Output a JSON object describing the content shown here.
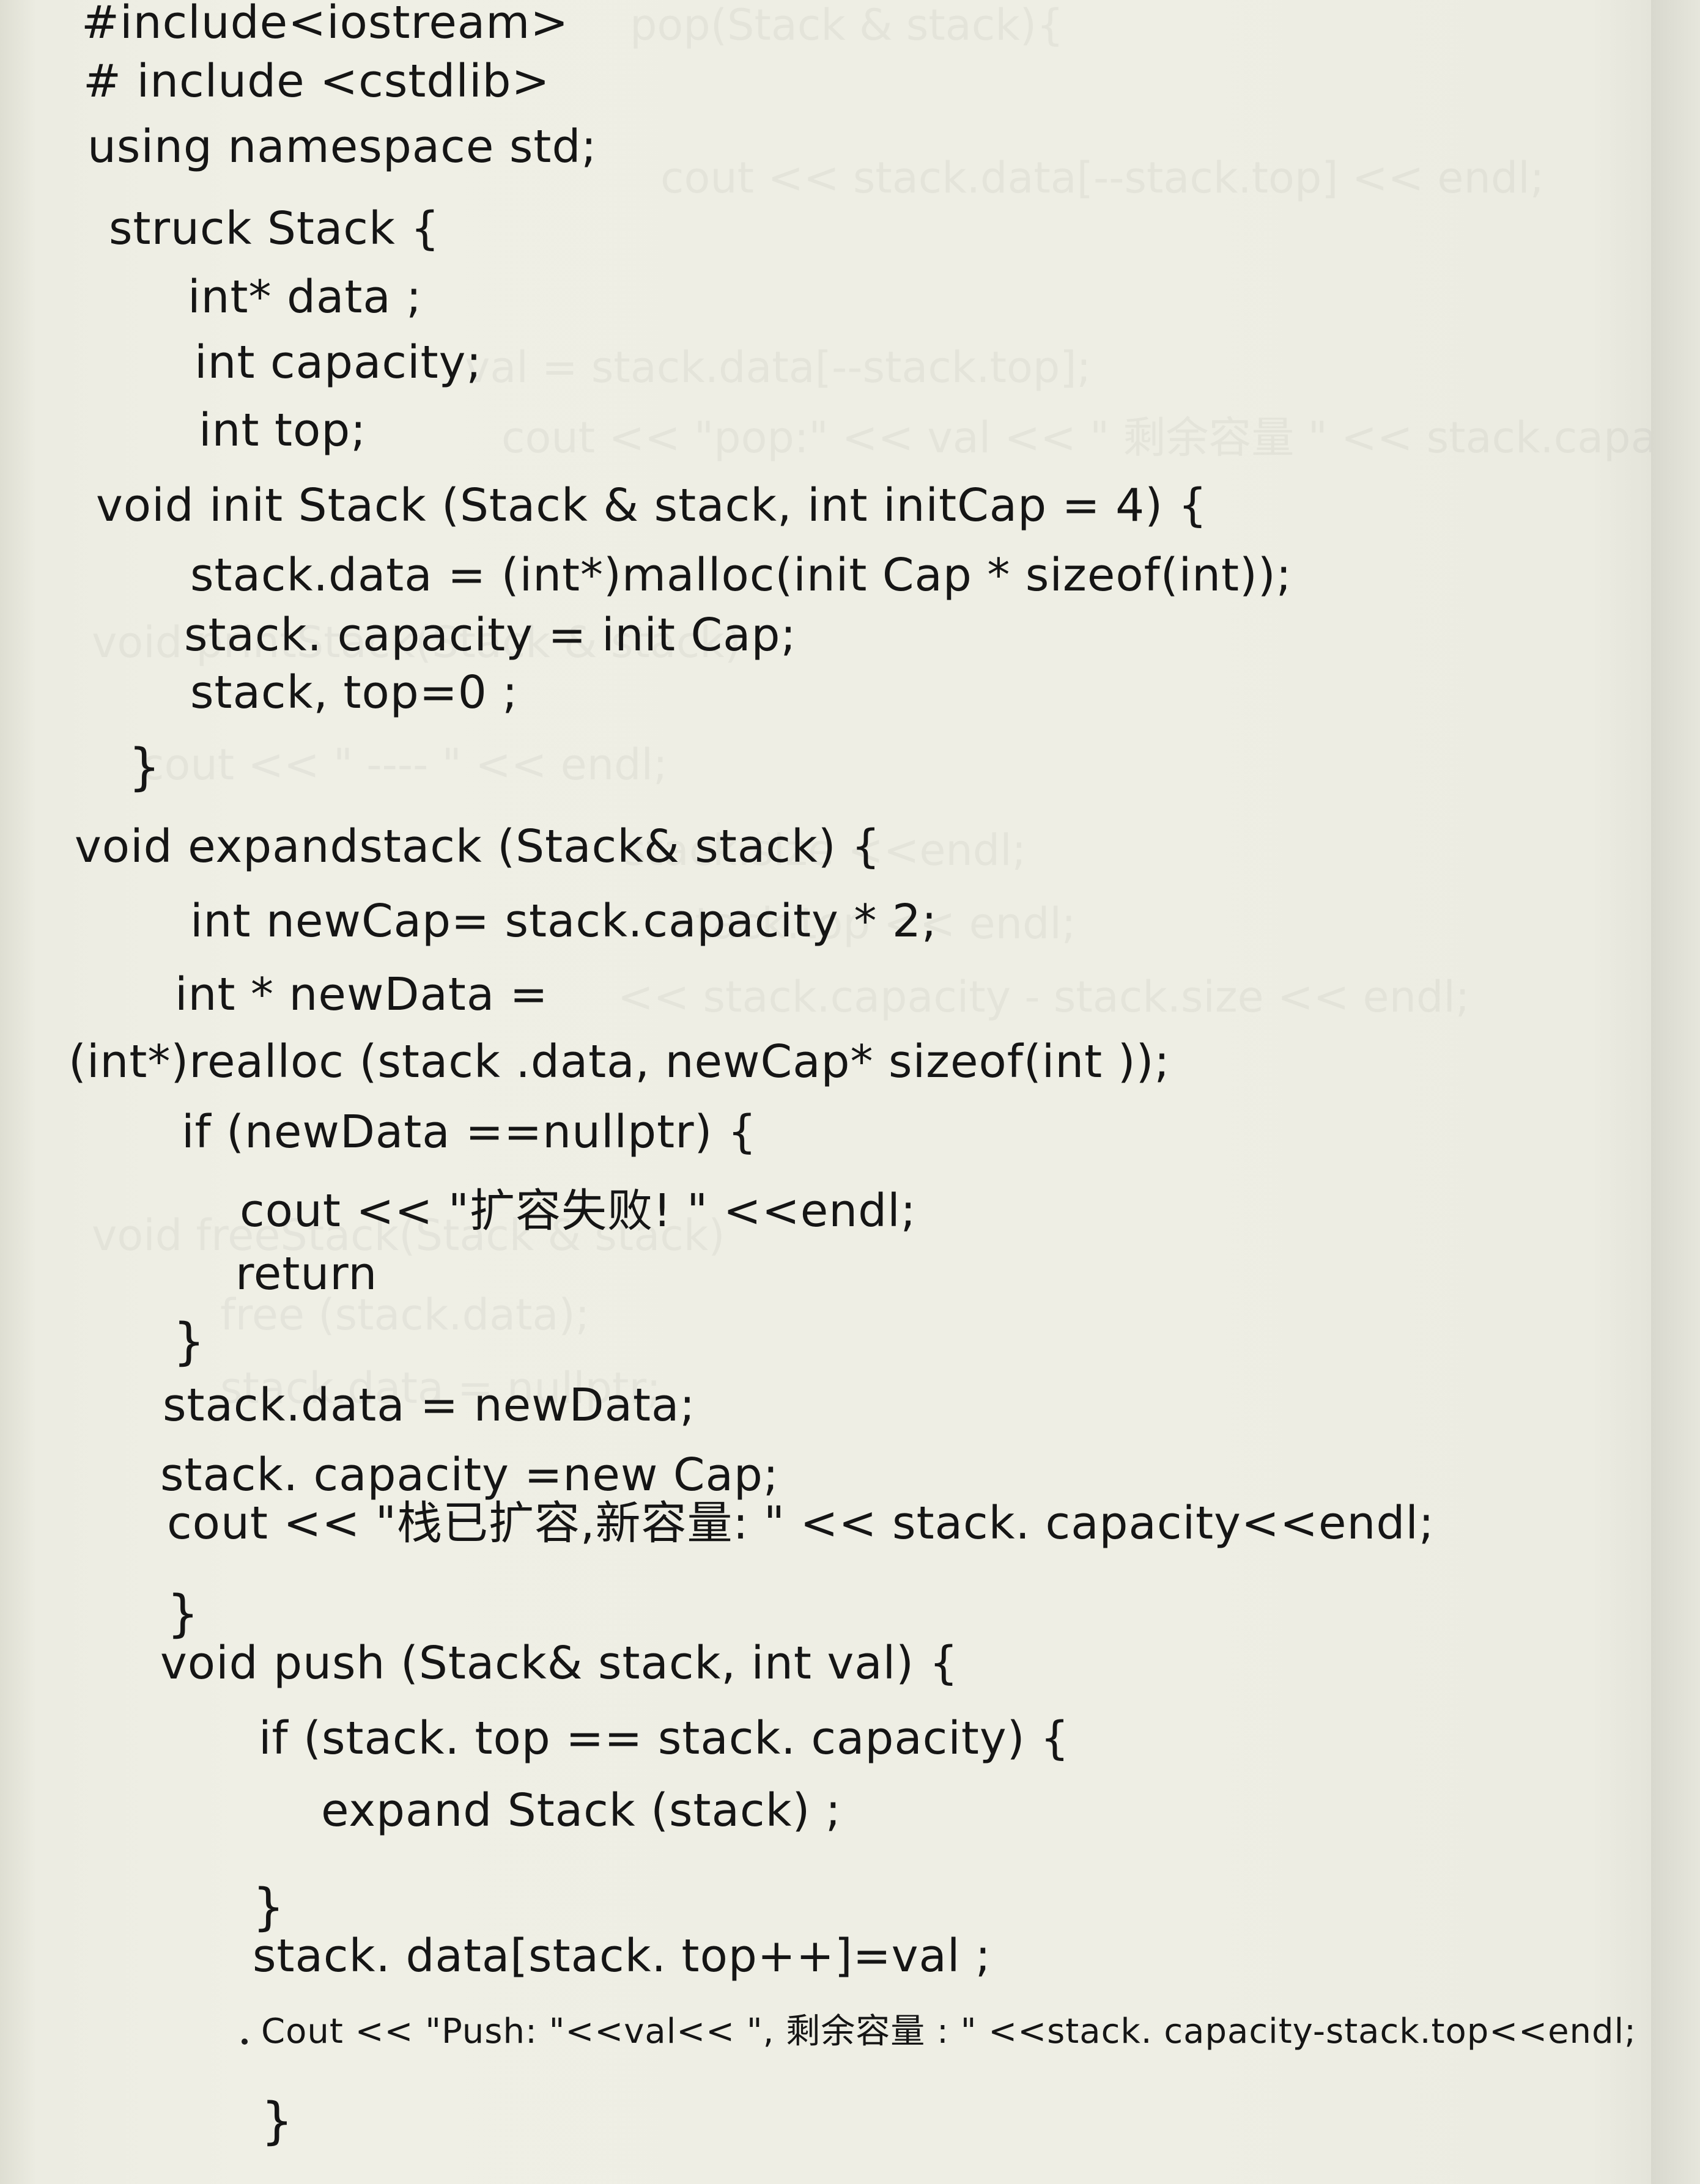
{
  "code_lines": [
    "#include<iostream>",
    "# include <cstdlib>",
    "using namespace std;",
    "struck Stack {",
    "int* data ;",
    "int capacity;",
    "int top;",
    "void init Stack (Stack & stack, int initCap = 4) {",
    "stack.data = (int*)malloc(init Cap * sizeof(int));",
    "stack. capacity = init Cap;",
    "stack, top=0 ;",
    "}",
    "void expandstack (Stack& stack) {",
    "int newCap= stack.capacity * 2;",
    "int * newData =",
    "(int*)realloc (stack .data, newCap* sizeof(int ));",
    "if (newData ==nullptr) {",
    "cout << \"扩容失败! \" <<endl;",
    "return",
    "}",
    "stack.data = newData;",
    "stack. capacity =new Cap;",
    "cout << \"栈已扩容,新容量: \" << stack. capacity<<endl;",
    "}",
    "void push (Stack& stack, int val) {",
    "if (stack. top == stack. capacity) {",
    "expand Stack (stack) ;",
    "}",
    "stack. data[stack. top++]=val ;",
    "Cout << \"Push: \"<<val<< \", 剩余容量 : \" <<stack. capacity-stack.top<<endl;",
    "}"
  ]
}
